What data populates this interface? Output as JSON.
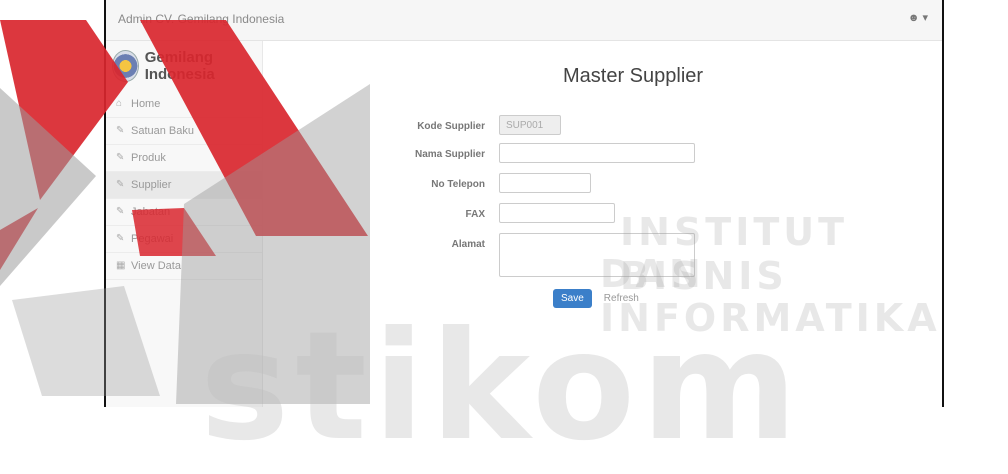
{
  "topbar": {
    "title": "Admin CV. Gemilang Indonesia",
    "user_icon": "user-icon"
  },
  "brand": {
    "name": "Gemilang Indonesia"
  },
  "sidebar": {
    "items": [
      {
        "label": "Home",
        "icon": "home-icon"
      },
      {
        "label": "Satuan Baku",
        "icon": "edit-icon"
      },
      {
        "label": "Produk",
        "icon": "edit-icon"
      },
      {
        "label": "Supplier",
        "icon": "edit-icon"
      },
      {
        "label": "Jabatan",
        "icon": "edit-icon"
      },
      {
        "label": "Pegawai",
        "icon": "edit-icon"
      },
      {
        "label": "View Data",
        "icon": "table-icon"
      }
    ]
  },
  "page": {
    "title": "Master Supplier"
  },
  "form": {
    "kode_label": "Kode Supplier",
    "kode_value": "SUP001",
    "nama_label": "Nama Supplier",
    "telp_label": "No Telepon",
    "fax_label": "FAX",
    "alamat_label": "Alamat",
    "save_label": "Save",
    "reset_label": "Refresh"
  },
  "watermark": {
    "line1": "INSTITUT BISNIS",
    "line2": "DAN INFORMATIKA",
    "line3": "stikom"
  },
  "colors": {
    "red": "#d9262e",
    "gray": "#9c9c9c",
    "primary": "#3b7fc9"
  }
}
